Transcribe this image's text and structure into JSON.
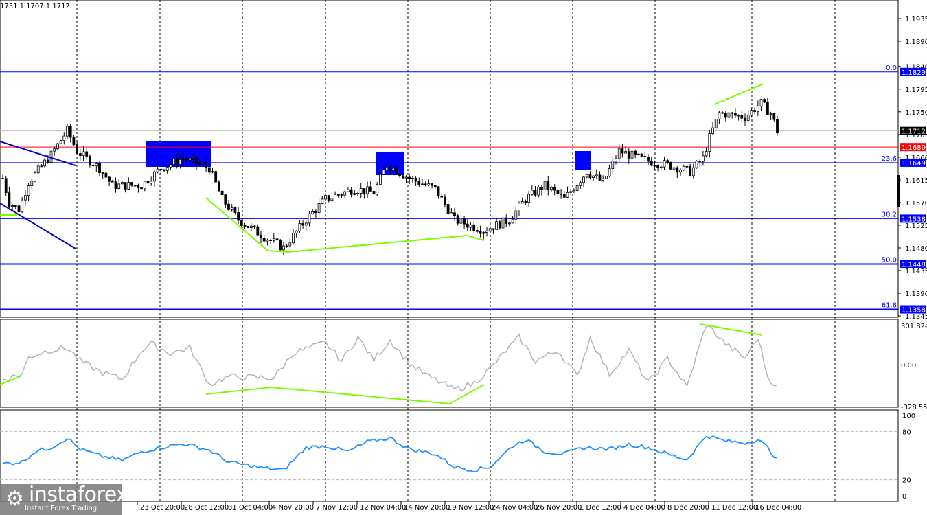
{
  "header": {
    "ohlc": "1731 1.1707 1.1712"
  },
  "logo": {
    "name": "instaforex",
    "tagline": "Instant Forex Trading"
  },
  "colors": {
    "candle": "#000000",
    "fib": "#0000ff",
    "resistance": "#ff0000",
    "divergence": "#7cfc00",
    "cci": "#b4b4b4",
    "rsi": "#1e90ff",
    "box": "#0000ff"
  },
  "chart_data": {
    "type": "candlestick",
    "ylim": [
      1.1345,
      1.196
    ],
    "price_ticks": [
      "1.1935",
      "1.1890",
      "1.1840",
      "1.1795",
      "1.1750",
      "1.1705",
      "1.1660",
      "1.1615",
      "1.1570",
      "1.1525",
      "1.1480",
      "1.1435",
      "1.1390",
      "1.1345"
    ],
    "current_price": {
      "value": 1.1712,
      "label": "1.1712"
    },
    "resistance": {
      "value": 1.168,
      "label": "1.1680"
    },
    "fib_levels": [
      {
        "level": "0.0",
        "value": 1.1829,
        "label": "1.1829"
      },
      {
        "level": "23.6",
        "value": 1.1649,
        "label": "1.1649"
      },
      {
        "level": "38.2",
        "value": 1.1538,
        "label": "1.1538"
      },
      {
        "level": "50.0",
        "value": 1.1448,
        "label": "1.1448"
      },
      {
        "level": "61.8",
        "value": 1.1358,
        "label": "1.1358"
      }
    ],
    "time_labels": [
      "23 Oct 20:00",
      "28 Oct 12:00",
      "31 Oct 04:00",
      "4 Nov 20:00",
      "7 Nov 12:00",
      "12 Nov 04:00",
      "14 Nov 20:00",
      "19 Nov 12:00",
      "24 Nov 04:00",
      "26 Nov 20:00",
      "1 Dec 12:00",
      "4 Dec 04:00",
      "8 Dec 20:00",
      "11 Dec 12:00",
      "16 Dec 04:00"
    ],
    "price_anchors": [
      [
        0,
        1.1618
      ],
      [
        2,
        1.157
      ],
      [
        5,
        1.1556
      ],
      [
        8,
        1.161
      ],
      [
        15,
        1.1665
      ],
      [
        20,
        1.1713
      ],
      [
        23,
        1.1672
      ],
      [
        30,
        1.1638
      ],
      [
        34,
        1.1604
      ],
      [
        43,
        1.1604
      ],
      [
        49,
        1.1638
      ],
      [
        56,
        1.1658
      ],
      [
        64,
        1.1638
      ],
      [
        68,
        1.1577
      ],
      [
        73,
        1.1536
      ],
      [
        81,
        1.1502
      ],
      [
        87,
        1.148
      ],
      [
        94,
        1.1536
      ],
      [
        100,
        1.1577
      ],
      [
        109,
        1.1597
      ],
      [
        115,
        1.159
      ],
      [
        119,
        1.1645
      ],
      [
        126,
        1.1618
      ],
      [
        134,
        1.1597
      ],
      [
        140,
        1.1536
      ],
      [
        149,
        1.1515
      ],
      [
        157,
        1.1536
      ],
      [
        162,
        1.1577
      ],
      [
        168,
        1.1604
      ],
      [
        174,
        1.1577
      ],
      [
        181,
        1.1631
      ],
      [
        186,
        1.161
      ],
      [
        191,
        1.1672
      ],
      [
        200,
        1.1652
      ],
      [
        206,
        1.1645
      ],
      [
        213,
        1.1631
      ],
      [
        217,
        1.1658
      ],
      [
        219,
        1.1699
      ],
      [
        222,
        1.1747
      ],
      [
        230,
        1.174
      ],
      [
        235,
        1.1767
      ],
      [
        238,
        1.1747
      ],
      [
        240,
        1.1713
      ]
    ],
    "cci": {
      "name": "CCI",
      "ticks": [
        "301.8242",
        "0.00",
        "-328.5513"
      ],
      "range": [
        -328.5513,
        301.8242
      ],
      "anchors": [
        [
          0,
          -120
        ],
        [
          6,
          -80
        ],
        [
          8,
          50
        ],
        [
          14,
          100
        ],
        [
          20,
          120
        ],
        [
          24,
          20
        ],
        [
          30,
          -60
        ],
        [
          37,
          -120
        ],
        [
          43,
          100
        ],
        [
          46,
          150
        ],
        [
          52,
          80
        ],
        [
          58,
          120
        ],
        [
          64,
          -160
        ],
        [
          70,
          -100
        ],
        [
          84,
          -110
        ],
        [
          90,
          80
        ],
        [
          95,
          120
        ],
        [
          100,
          160
        ],
        [
          105,
          20
        ],
        [
          110,
          200
        ],
        [
          115,
          30
        ],
        [
          120,
          180
        ],
        [
          126,
          0
        ],
        [
          132,
          -100
        ],
        [
          140,
          -200
        ],
        [
          146,
          -150
        ],
        [
          151,
          -40
        ],
        [
          156,
          100
        ],
        [
          160,
          200
        ],
        [
          165,
          20
        ],
        [
          172,
          100
        ],
        [
          178,
          -100
        ],
        [
          182,
          200
        ],
        [
          188,
          -80
        ],
        [
          194,
          100
        ],
        [
          200,
          -150
        ],
        [
          206,
          40
        ],
        [
          212,
          -180
        ],
        [
          218,
          301
        ],
        [
          224,
          150
        ],
        [
          230,
          40
        ],
        [
          234,
          200
        ],
        [
          237,
          -100
        ],
        [
          240,
          -180
        ]
      ]
    },
    "rsi": {
      "name": "RSI",
      "ticks": [
        "100",
        "80",
        "20",
        "0"
      ],
      "range": [
        0,
        100
      ],
      "anchors": [
        [
          0,
          40
        ],
        [
          6,
          42
        ],
        [
          10,
          55
        ],
        [
          15,
          60
        ],
        [
          20,
          72
        ],
        [
          24,
          58
        ],
        [
          30,
          50
        ],
        [
          37,
          44
        ],
        [
          43,
          55
        ],
        [
          49,
          60
        ],
        [
          56,
          65
        ],
        [
          64,
          57
        ],
        [
          70,
          42
        ],
        [
          80,
          35
        ],
        [
          87,
          32
        ],
        [
          94,
          60
        ],
        [
          100,
          62
        ],
        [
          107,
          55
        ],
        [
          113,
          67
        ],
        [
          120,
          72
        ],
        [
          126,
          58
        ],
        [
          134,
          52
        ],
        [
          140,
          36
        ],
        [
          146,
          32
        ],
        [
          151,
          36
        ],
        [
          158,
          62
        ],
        [
          162,
          70
        ],
        [
          168,
          55
        ],
        [
          174,
          52
        ],
        [
          180,
          60
        ],
        [
          188,
          58
        ],
        [
          194,
          64
        ],
        [
          200,
          60
        ],
        [
          206,
          52
        ],
        [
          212,
          45
        ],
        [
          218,
          75
        ],
        [
          224,
          68
        ],
        [
          230,
          66
        ],
        [
          234,
          70
        ],
        [
          237,
          60
        ],
        [
          240,
          45
        ]
      ]
    }
  }
}
